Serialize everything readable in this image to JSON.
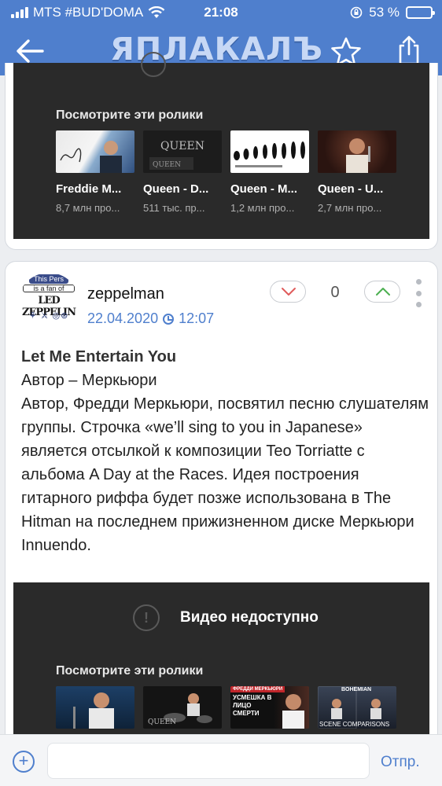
{
  "status_bar": {
    "carrier": "MTS #BUD'DOMA",
    "time": "21:08",
    "battery_percent": "53 %",
    "battery_level": 0.53
  },
  "navbar": {
    "logo_text": "ЯПЛАКАЛЪ"
  },
  "video_block_1": {
    "title": "Посмотрите эти ролики",
    "videos": [
      {
        "title": "Freddie M...",
        "meta": "8,7 млн про..."
      },
      {
        "title": "Queen - D...",
        "meta": "511 тыс. пр..."
      },
      {
        "title": "Queen - M...",
        "meta": "1,2 млн про..."
      },
      {
        "title": "Queen - U...",
        "meta": "2,7 млн про..."
      }
    ]
  },
  "post": {
    "username": "zeppelman",
    "date": "22.04.2020",
    "time": "12:07",
    "vote_count": "0",
    "avatar_text": {
      "line1": "This Pers",
      "line2": "is a fan of",
      "band": "LED ZEPPELIN"
    },
    "title": "Let Me Entertain You",
    "body": "Автор – Меркьюри\nАвтор, Фредди Меркьюри, посвятил песню слушателям группы. Строчка «we’ll sing to you in Japanese» является отсылкой к композиции Teo Torriatte с альбома A Day at the Races. Идея построения гитарного риффа будет позже использована в The Hitman на последнем прижизненном диске Меркьюри Innuendo."
  },
  "video_block_2": {
    "unavailable_text": "Видео недоступно",
    "title": "Посмотрите эти ролики",
    "thumb_captions": [
      "QUEEN",
      "УСМЕШКА В ЛИЦО СМЕРТИ",
      "SCENE COMPARISONS"
    ],
    "thumb_headers": [
      "ФРЕДДИ МЕРКЬЮРИ",
      "BOHEMIAN"
    ]
  },
  "composer": {
    "placeholder": "",
    "send_label": "Отпр."
  }
}
